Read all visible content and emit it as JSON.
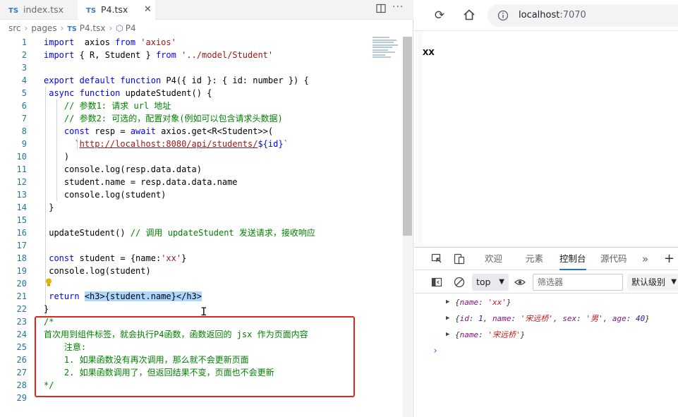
{
  "editor": {
    "tabs": [
      {
        "badge": "TS",
        "label": "index.tsx"
      },
      {
        "badge": "TS",
        "label": "P4.tsx"
      }
    ],
    "breadcrumb": {
      "src": "src",
      "pages": "pages",
      "file_badge": "TS",
      "file": "P4.tsx",
      "symbol": "P4"
    },
    "lines": [
      {
        "n": "1",
        "segs": [
          [
            "kw",
            "import"
          ],
          [
            "",
            "  axios "
          ],
          [
            "kw",
            "from"
          ],
          [
            "str",
            " 'axios'"
          ]
        ]
      },
      {
        "n": "2",
        "segs": [
          [
            "kw",
            "import"
          ],
          [
            "",
            " { R, Student } "
          ],
          [
            "kw",
            "from"
          ],
          [
            "str",
            " '../model/Student'"
          ]
        ]
      },
      {
        "n": "3",
        "segs": []
      },
      {
        "n": "4",
        "segs": [
          [
            "kw",
            "export"
          ],
          [
            "",
            " "
          ],
          [
            "kw",
            "default"
          ],
          [
            "",
            " "
          ],
          [
            "kw",
            "function"
          ],
          [
            "",
            " P4({ id }: { id: number }) {"
          ]
        ]
      },
      {
        "n": "5",
        "segs": [
          [
            "",
            " "
          ],
          [
            "kw",
            "async"
          ],
          [
            "",
            " "
          ],
          [
            "kw",
            "function"
          ],
          [
            "",
            " updateStudent() {"
          ]
        ]
      },
      {
        "n": "6",
        "segs": [
          [
            "cm",
            "    // 参数1: 请求 url 地址"
          ]
        ]
      },
      {
        "n": "7",
        "segs": [
          [
            "cm",
            "    // 参数2: 可选的，配置对象(例如可以包含请求头数据)"
          ]
        ]
      },
      {
        "n": "8",
        "segs": [
          [
            "",
            "    "
          ],
          [
            "kw",
            "const"
          ],
          [
            "",
            " resp = "
          ],
          [
            "kw",
            "await"
          ],
          [
            "",
            " axios.get<R<Student>>("
          ]
        ]
      },
      {
        "n": "9",
        "segs": [
          [
            "str",
            "      `"
          ],
          [
            "url",
            "http://localhost:8080/api/students/"
          ],
          [
            "tpl",
            "${id}"
          ],
          [
            "str",
            "`"
          ]
        ]
      },
      {
        "n": "10",
        "segs": [
          [
            "",
            "    )"
          ]
        ]
      },
      {
        "n": "11",
        "segs": [
          [
            "",
            "    console.log(resp.data.data)"
          ]
        ]
      },
      {
        "n": "12",
        "segs": [
          [
            "",
            "    student.name = resp.data.data.name"
          ]
        ]
      },
      {
        "n": "13",
        "segs": [
          [
            "",
            "    console.log(student)"
          ]
        ]
      },
      {
        "n": "14",
        "segs": [
          [
            "",
            " }"
          ]
        ]
      },
      {
        "n": "15",
        "segs": []
      },
      {
        "n": "16",
        "segs": [
          [
            "",
            " updateStudent() "
          ],
          [
            "cm",
            "// 调用 updateStudent 发送请求，接收响应"
          ]
        ]
      },
      {
        "n": "17",
        "segs": []
      },
      {
        "n": "18",
        "segs": [
          [
            "",
            " "
          ],
          [
            "kw",
            "const"
          ],
          [
            "",
            " student = {name:"
          ],
          [
            "str",
            "'xx'"
          ],
          [
            "",
            "}"
          ]
        ]
      },
      {
        "n": "19",
        "segs": [
          [
            "",
            " console.log(student)"
          ]
        ]
      },
      {
        "n": "20",
        "segs": []
      },
      {
        "n": "21",
        "segs": [
          [
            "",
            " "
          ],
          [
            "kw",
            "return"
          ],
          [
            "",
            " "
          ],
          [
            "sel",
            "<h3>{student.name}</h3>"
          ]
        ]
      },
      {
        "n": "22",
        "segs": [
          [
            "",
            "}"
          ]
        ]
      },
      {
        "n": "23",
        "segs": [
          [
            "cm",
            "/*"
          ]
        ]
      },
      {
        "n": "24",
        "segs": [
          [
            "cm",
            "首次用到组件标签，就会执行P4函数，函数返回的 jsx 作为页面内容"
          ]
        ]
      },
      {
        "n": "25",
        "segs": [
          [
            "cm",
            "    注意:"
          ]
        ]
      },
      {
        "n": "26",
        "segs": [
          [
            "cm",
            "    1. 如果函数没有再次调用，那么就不会更新页面"
          ]
        ]
      },
      {
        "n": "27",
        "segs": [
          [
            "cm",
            "    2. 如果函数调用了，但返回结果不变，页面也不会更新"
          ]
        ]
      },
      {
        "n": "28",
        "segs": [
          [
            "cm",
            "*/"
          ]
        ]
      },
      {
        "n": "29",
        "segs": []
      }
    ]
  },
  "browser": {
    "url_host": "localhost",
    "url_port": ":7070",
    "page_heading": "xx"
  },
  "devtools": {
    "tabs": [
      "欢迎",
      "元素",
      "控制台",
      "源代码"
    ],
    "active_tab": "控制台",
    "context": "top",
    "filter_placeholder": "筛选器",
    "level": "默认级别",
    "console_rows": [
      [
        [
          "",
          "{"
        ],
        [
          "c-key",
          "name"
        ],
        [
          "",
          ": "
        ],
        [
          "c-str",
          "'xx'"
        ],
        [
          "",
          "}"
        ]
      ],
      [
        [
          "",
          "{"
        ],
        [
          "c-key",
          "id"
        ],
        [
          "",
          ": "
        ],
        [
          "c-num",
          "1"
        ],
        [
          "",
          ", "
        ],
        [
          "c-key",
          "name"
        ],
        [
          "",
          ": "
        ],
        [
          "c-str",
          "'宋远桥'"
        ],
        [
          "",
          ", "
        ],
        [
          "c-key",
          "sex"
        ],
        [
          "",
          ": "
        ],
        [
          "c-str",
          "'男'"
        ],
        [
          "",
          ", "
        ],
        [
          "c-key",
          "age"
        ],
        [
          "",
          ": "
        ],
        [
          "c-num",
          "40"
        ],
        [
          "",
          "}"
        ]
      ],
      [
        [
          "",
          "{"
        ],
        [
          "c-key",
          "name"
        ],
        [
          "",
          ": "
        ],
        [
          "c-str",
          "'宋远桥'"
        ],
        [
          "",
          "}"
        ]
      ]
    ]
  },
  "icons": {
    "editor_actions": [
      "split-editor-icon",
      "more-icon"
    ],
    "browser_nav": [
      "reload-icon",
      "home-icon",
      "info-icon"
    ],
    "devtools": [
      "inspect-icon",
      "device-toolbar-icon",
      "more-tabs-icon",
      "add-tab-icon",
      "sidebar-toggle-icon",
      "clear-console-icon",
      "eye-icon",
      "lightbulb-icon"
    ]
  },
  "colors": {
    "keyword": "#0000ff",
    "string": "#a31515",
    "comment": "#008000",
    "highlight_border": "#e8231b",
    "selection": "#add6ff"
  }
}
